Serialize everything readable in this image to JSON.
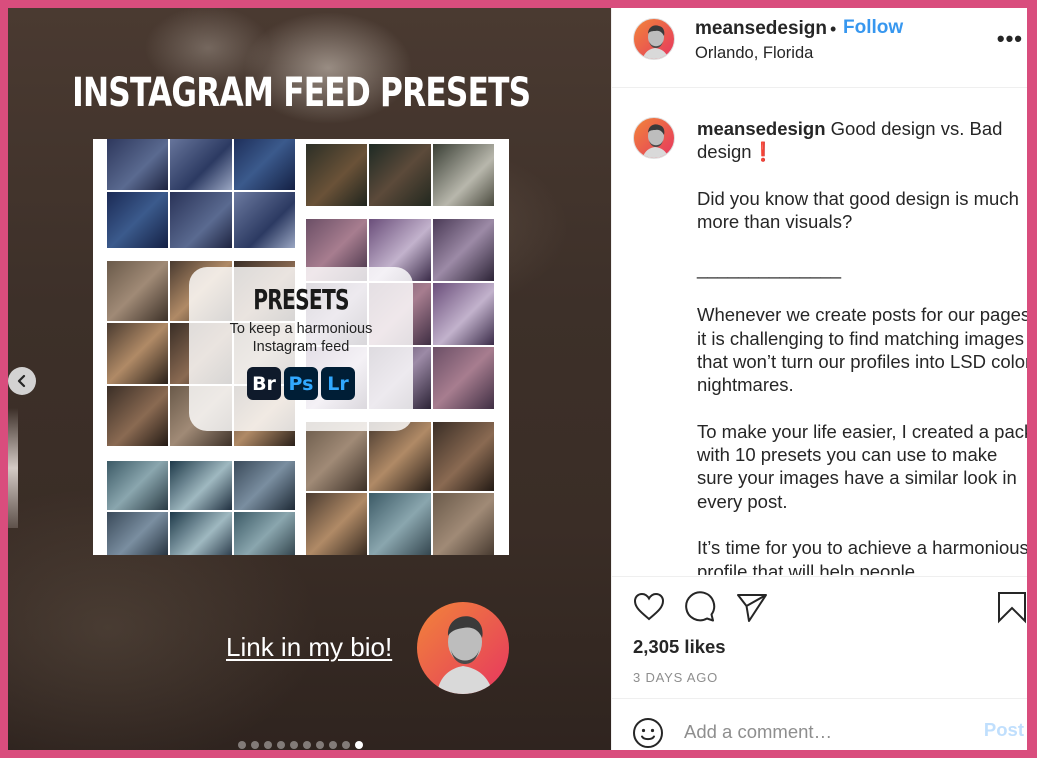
{
  "post_media": {
    "title": "INSTAGRAM FEED PRESETS",
    "card": {
      "title": "PRESETS",
      "subtitle_line1": "To keep a harmonious",
      "subtitle_line2": "Instagram feed",
      "apps": [
        "Br",
        "Ps",
        "Lr"
      ]
    },
    "link_text": "Link in my bio!",
    "carousel": {
      "total_slides": 10,
      "active_slide": 10
    },
    "prev_icon": "chevron-left-icon"
  },
  "header": {
    "username": "meansedesign",
    "separator": "•",
    "follow_label": "Follow",
    "location": "Orlando, Florida",
    "more_icon": "•••"
  },
  "caption": {
    "username": "meansedesign",
    "title": " Good design vs. Bad design",
    "emphasis": "❗",
    "body": "\n\nDid you know that good design is much more than visuals?\n\n______________\n\nWhenever we create posts for our pages, it is challenging to find matching images that won’t turn our profiles into LSD color nightmares.\n\nTo make your life easier, I created a pack with 10 presets you can use to make sure your images have a similar look in every post.\n\nIt’s time for you to achieve a harmonious profile that will help people"
  },
  "actions": {
    "icons": [
      "heart-icon",
      "comment-icon",
      "share-icon",
      "bookmark-icon"
    ],
    "likes": "2,305 likes",
    "timestamp": "3 DAYS AGO"
  },
  "comment": {
    "placeholder": "Add a comment…",
    "post_label": "Post"
  },
  "colors": {
    "frame_border": "#d94d7d",
    "follow_blue": "#3797ef",
    "post_disabled": "#c0dffd",
    "text_primary": "#262626",
    "text_secondary": "#8e8e8e"
  }
}
